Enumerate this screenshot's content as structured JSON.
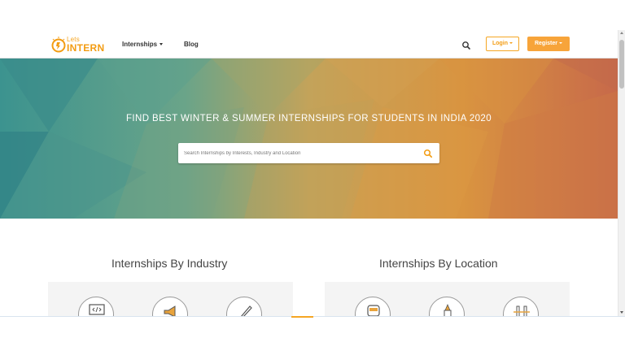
{
  "navbar": {
    "logo_small": "Lets",
    "logo_big": "INTERN",
    "links": [
      {
        "label": "Internships",
        "has_caret": true
      },
      {
        "label": "Blog",
        "has_caret": false
      }
    ],
    "search_icon": "search-icon",
    "login_label": "Login",
    "register_label": "Register"
  },
  "hero": {
    "title": "FIND BEST WINTER & SUMMER INTERNSHIPS FOR STUDENTS IN INDIA 2020",
    "search_placeholder": "Search Internships by Interests, Industry and Location",
    "search_icon": "search-icon"
  },
  "sections": {
    "industry": {
      "title": "Internships By Industry",
      "icons": [
        "code-monitor-icon",
        "megaphone-icon",
        "pen-icon"
      ]
    },
    "location": {
      "title": "Internships By Location",
      "icons": [
        "train-icon",
        "temple-icon",
        "bridge-icon"
      ]
    }
  },
  "colors": {
    "brand_orange": "#f7a43a",
    "hero_teal": "#3e9a95",
    "hero_orange": "#d9893f"
  }
}
